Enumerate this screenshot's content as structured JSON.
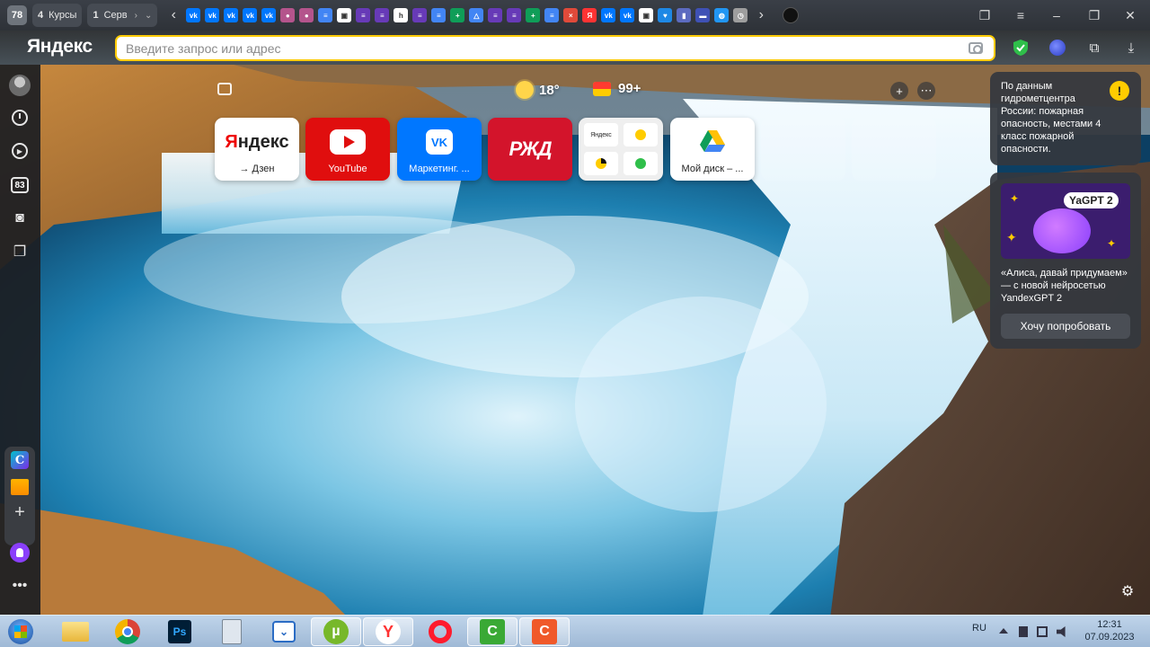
{
  "tabstrip": {
    "tab_count": "78",
    "group_tabs": [
      {
        "num": "4",
        "label": "Курсы"
      },
      {
        "num": "1",
        "label": "Серв"
      }
    ],
    "pinned_tabs": [
      {
        "icon": "vk-icon",
        "color": "#0077ff",
        "glyph": "vk"
      },
      {
        "icon": "vk-icon",
        "color": "#0077ff",
        "glyph": "vk"
      },
      {
        "icon": "vk-icon",
        "color": "#0077ff",
        "glyph": "vk"
      },
      {
        "icon": "vk-icon",
        "color": "#0077ff",
        "glyph": "vk"
      },
      {
        "icon": "vk-icon",
        "color": "#0077ff",
        "glyph": "vk"
      },
      {
        "icon": "profile-photo-icon",
        "color": "#b4548c",
        "glyph": "●"
      },
      {
        "icon": "profile-photo-icon",
        "color": "#b4548c",
        "glyph": "●"
      },
      {
        "icon": "docs-icon",
        "color": "#4285f4",
        "glyph": "≡"
      },
      {
        "icon": "image-icon",
        "color": "#ffffff",
        "glyph": "▣"
      },
      {
        "icon": "form-icon",
        "color": "#673ab7",
        "glyph": "≡"
      },
      {
        "icon": "form-icon",
        "color": "#673ab7",
        "glyph": "≡"
      },
      {
        "icon": "habr-icon",
        "color": "#ffffff",
        "glyph": "h"
      },
      {
        "icon": "form-icon",
        "color": "#673ab7",
        "glyph": "≡"
      },
      {
        "icon": "docs-icon",
        "color": "#4285f4",
        "glyph": "≡"
      },
      {
        "icon": "sheets-icon",
        "color": "#0f9d58",
        "glyph": "+"
      },
      {
        "icon": "drive-icon",
        "color": "#4285f4",
        "glyph": "△"
      },
      {
        "icon": "form-icon",
        "color": "#673ab7",
        "glyph": "≡"
      },
      {
        "icon": "form-icon",
        "color": "#673ab7",
        "glyph": "≡"
      },
      {
        "icon": "sheets-icon",
        "color": "#0f9d58",
        "glyph": "+"
      },
      {
        "icon": "docs-icon",
        "color": "#4285f4",
        "glyph": "≡"
      },
      {
        "icon": "cross-icon",
        "color": "#e04a3a",
        "glyph": "×"
      },
      {
        "icon": "yandex-icon",
        "color": "#ff3333",
        "glyph": "Я"
      },
      {
        "icon": "vk-icon",
        "color": "#0077ff",
        "glyph": "vk"
      },
      {
        "icon": "vk-icon",
        "color": "#0077ff",
        "glyph": "vk"
      },
      {
        "icon": "image-icon",
        "color": "#ffffff",
        "glyph": "▣"
      },
      {
        "icon": "heart-icon",
        "color": "#1e88e5",
        "glyph": "♥"
      },
      {
        "icon": "phone-icon",
        "color": "#5c6bc0",
        "glyph": "▮"
      },
      {
        "icon": "app-icon",
        "color": "#3f51b5",
        "glyph": "▬"
      },
      {
        "icon": "globe-icon",
        "color": "#2196f3",
        "glyph": "◍"
      },
      {
        "icon": "clock-icon",
        "color": "#9e9e9e",
        "glyph": "◷"
      }
    ]
  },
  "addressbar": {
    "logo": "Яндекс",
    "placeholder": "Введите запрос или адрес"
  },
  "sidebar": {
    "badge": "83"
  },
  "informers": {
    "temperature": "18°",
    "mail_count": "99+"
  },
  "speed_dial": [
    {
      "label": "→ Дзен",
      "logo": "Яндекс",
      "bg": "#ffffff",
      "fg": "#222222"
    },
    {
      "label": "YouTube",
      "bg": "#e00e0e",
      "fg": "#ffffff"
    },
    {
      "label": "Маркетинг. ...",
      "bg": "#0077ff",
      "fg": "#ffffff"
    },
    {
      "label": "",
      "logo": "РЖД",
      "bg": "#d3142b",
      "fg": "#ffffff"
    },
    {
      "label": "",
      "folder_label": "Яндекс",
      "bg": "#efefef",
      "fg": "#222222"
    },
    {
      "label": "Мой диск – ...",
      "bg": "#ffffff",
      "fg": "#222222"
    }
  ],
  "notifications": {
    "fire_alert": "По данным гидрометцентра России: пожарная опасность, местами 4 класс пожарной опасности.",
    "yagpt_badge": "YaGPT 2",
    "yagpt_text": "«Алиса, давай придумаем» — с новой нейросетью YandexGPT 2",
    "yagpt_button": "Хочу попробовать"
  },
  "taskbar": {
    "language": "RU",
    "time": "12:31",
    "date": "07.09.2023"
  }
}
